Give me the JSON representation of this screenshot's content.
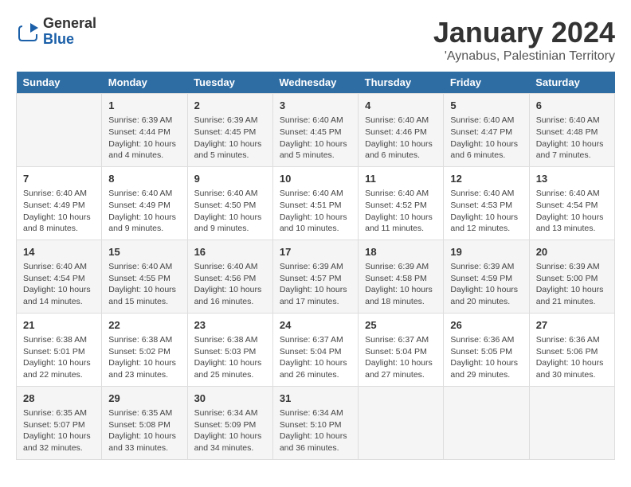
{
  "logo": {
    "general": "General",
    "blue": "Blue"
  },
  "title": "January 2024",
  "subtitle": "'Aynabus, Palestinian Territory",
  "days_header": [
    "Sunday",
    "Monday",
    "Tuesday",
    "Wednesday",
    "Thursday",
    "Friday",
    "Saturday"
  ],
  "weeks": [
    [
      {
        "day": "",
        "info": ""
      },
      {
        "day": "1",
        "info": "Sunrise: 6:39 AM\nSunset: 4:44 PM\nDaylight: 10 hours\nand 4 minutes."
      },
      {
        "day": "2",
        "info": "Sunrise: 6:39 AM\nSunset: 4:45 PM\nDaylight: 10 hours\nand 5 minutes."
      },
      {
        "day": "3",
        "info": "Sunrise: 6:40 AM\nSunset: 4:45 PM\nDaylight: 10 hours\nand 5 minutes."
      },
      {
        "day": "4",
        "info": "Sunrise: 6:40 AM\nSunset: 4:46 PM\nDaylight: 10 hours\nand 6 minutes."
      },
      {
        "day": "5",
        "info": "Sunrise: 6:40 AM\nSunset: 4:47 PM\nDaylight: 10 hours\nand 6 minutes."
      },
      {
        "day": "6",
        "info": "Sunrise: 6:40 AM\nSunset: 4:48 PM\nDaylight: 10 hours\nand 7 minutes."
      }
    ],
    [
      {
        "day": "7",
        "info": "Sunrise: 6:40 AM\nSunset: 4:49 PM\nDaylight: 10 hours\nand 8 minutes."
      },
      {
        "day": "8",
        "info": "Sunrise: 6:40 AM\nSunset: 4:49 PM\nDaylight: 10 hours\nand 9 minutes."
      },
      {
        "day": "9",
        "info": "Sunrise: 6:40 AM\nSunset: 4:50 PM\nDaylight: 10 hours\nand 9 minutes."
      },
      {
        "day": "10",
        "info": "Sunrise: 6:40 AM\nSunset: 4:51 PM\nDaylight: 10 hours\nand 10 minutes."
      },
      {
        "day": "11",
        "info": "Sunrise: 6:40 AM\nSunset: 4:52 PM\nDaylight: 10 hours\nand 11 minutes."
      },
      {
        "day": "12",
        "info": "Sunrise: 6:40 AM\nSunset: 4:53 PM\nDaylight: 10 hours\nand 12 minutes."
      },
      {
        "day": "13",
        "info": "Sunrise: 6:40 AM\nSunset: 4:54 PM\nDaylight: 10 hours\nand 13 minutes."
      }
    ],
    [
      {
        "day": "14",
        "info": "Sunrise: 6:40 AM\nSunset: 4:54 PM\nDaylight: 10 hours\nand 14 minutes."
      },
      {
        "day": "15",
        "info": "Sunrise: 6:40 AM\nSunset: 4:55 PM\nDaylight: 10 hours\nand 15 minutes."
      },
      {
        "day": "16",
        "info": "Sunrise: 6:40 AM\nSunset: 4:56 PM\nDaylight: 10 hours\nand 16 minutes."
      },
      {
        "day": "17",
        "info": "Sunrise: 6:39 AM\nSunset: 4:57 PM\nDaylight: 10 hours\nand 17 minutes."
      },
      {
        "day": "18",
        "info": "Sunrise: 6:39 AM\nSunset: 4:58 PM\nDaylight: 10 hours\nand 18 minutes."
      },
      {
        "day": "19",
        "info": "Sunrise: 6:39 AM\nSunset: 4:59 PM\nDaylight: 10 hours\nand 20 minutes."
      },
      {
        "day": "20",
        "info": "Sunrise: 6:39 AM\nSunset: 5:00 PM\nDaylight: 10 hours\nand 21 minutes."
      }
    ],
    [
      {
        "day": "21",
        "info": "Sunrise: 6:38 AM\nSunset: 5:01 PM\nDaylight: 10 hours\nand 22 minutes."
      },
      {
        "day": "22",
        "info": "Sunrise: 6:38 AM\nSunset: 5:02 PM\nDaylight: 10 hours\nand 23 minutes."
      },
      {
        "day": "23",
        "info": "Sunrise: 6:38 AM\nSunset: 5:03 PM\nDaylight: 10 hours\nand 25 minutes."
      },
      {
        "day": "24",
        "info": "Sunrise: 6:37 AM\nSunset: 5:04 PM\nDaylight: 10 hours\nand 26 minutes."
      },
      {
        "day": "25",
        "info": "Sunrise: 6:37 AM\nSunset: 5:04 PM\nDaylight: 10 hours\nand 27 minutes."
      },
      {
        "day": "26",
        "info": "Sunrise: 6:36 AM\nSunset: 5:05 PM\nDaylight: 10 hours\nand 29 minutes."
      },
      {
        "day": "27",
        "info": "Sunrise: 6:36 AM\nSunset: 5:06 PM\nDaylight: 10 hours\nand 30 minutes."
      }
    ],
    [
      {
        "day": "28",
        "info": "Sunrise: 6:35 AM\nSunset: 5:07 PM\nDaylight: 10 hours\nand 32 minutes."
      },
      {
        "day": "29",
        "info": "Sunrise: 6:35 AM\nSunset: 5:08 PM\nDaylight: 10 hours\nand 33 minutes."
      },
      {
        "day": "30",
        "info": "Sunrise: 6:34 AM\nSunset: 5:09 PM\nDaylight: 10 hours\nand 34 minutes."
      },
      {
        "day": "31",
        "info": "Sunrise: 6:34 AM\nSunset: 5:10 PM\nDaylight: 10 hours\nand 36 minutes."
      },
      {
        "day": "",
        "info": ""
      },
      {
        "day": "",
        "info": ""
      },
      {
        "day": "",
        "info": ""
      }
    ]
  ]
}
